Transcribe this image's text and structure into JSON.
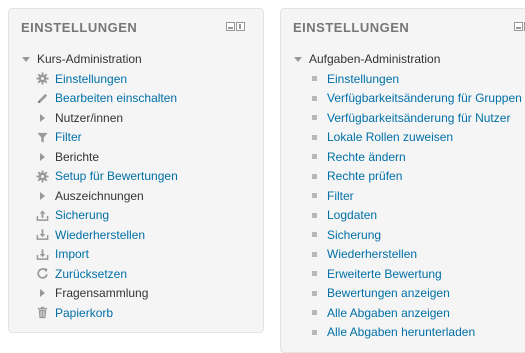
{
  "left_block": {
    "title": "EINSTELLUNGEN",
    "root": "Kurs-Administration",
    "items": [
      {
        "label": "Einstellungen",
        "icon": "gear-icon",
        "link": true
      },
      {
        "label": "Bearbeiten einschalten",
        "icon": "pencil-icon",
        "link": true
      },
      {
        "label": "Nutzer/innen",
        "icon": "expand-arrow-icon",
        "link": false
      },
      {
        "label": "Filter",
        "icon": "filter-icon",
        "link": true
      },
      {
        "label": "Berichte",
        "icon": "expand-arrow-icon",
        "link": false
      },
      {
        "label": "Setup für Bewertungen",
        "icon": "gear-icon",
        "link": true
      },
      {
        "label": "Auszeichnungen",
        "icon": "expand-arrow-icon",
        "link": false
      },
      {
        "label": "Sicherung",
        "icon": "backup-upload-icon",
        "link": true
      },
      {
        "label": "Wiederherstellen",
        "icon": "restore-download-icon",
        "link": true
      },
      {
        "label": "Import",
        "icon": "import-icon",
        "link": true
      },
      {
        "label": "Zurücksetzen",
        "icon": "reset-icon",
        "link": true
      },
      {
        "label": "Fragensammlung",
        "icon": "expand-arrow-icon",
        "link": false
      },
      {
        "label": "Papierkorb",
        "icon": "trash-icon",
        "link": true
      }
    ]
  },
  "right_block": {
    "title": "EINSTELLUNGEN",
    "root": "Aufgaben-Administration",
    "items": [
      {
        "label": "Einstellungen"
      },
      {
        "label": "Verfügbarkeitsänderung für Gruppen"
      },
      {
        "label": "Verfügbarkeitsänderung für Nutzer"
      },
      {
        "label": "Lokale Rollen zuweisen"
      },
      {
        "label": "Rechte ändern"
      },
      {
        "label": "Rechte prüfen"
      },
      {
        "label": "Filter"
      },
      {
        "label": "Logdaten"
      },
      {
        "label": "Sicherung"
      },
      {
        "label": "Wiederherstellen"
      },
      {
        "label": "Erweiterte Bewertung"
      },
      {
        "label": "Bewertungen anzeigen"
      },
      {
        "label": "Alle Abgaben anzeigen"
      },
      {
        "label": "Alle Abgaben herunterladen"
      }
    ]
  },
  "colors": {
    "link": "#0070a8",
    "text": "#333333",
    "header": "#777777",
    "icon": "#999999",
    "block_bg": "#f5f5f5"
  }
}
